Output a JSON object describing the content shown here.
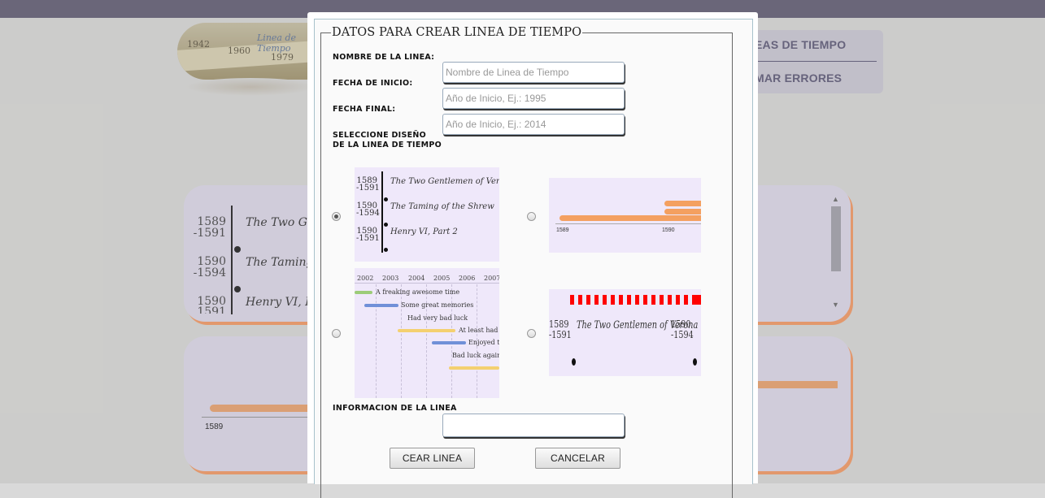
{
  "background": {
    "logo": {
      "text": "Linea de Tiempo",
      "years": [
        "1942",
        "1960",
        "1979"
      ]
    },
    "menu": {
      "item1": "EAS DE TIEMPO",
      "item2": "MAR ERRORES"
    },
    "card1": {
      "entries": [
        {
          "start": "1589",
          "end": "-1591",
          "title": "The Two Ge"
        },
        {
          "start": "1590",
          "end": "-1594",
          "title": "The Taming"
        },
        {
          "start": "1590",
          "end": "1591",
          "title": "Henry VI, P"
        }
      ]
    },
    "card2": {
      "axis_label": "1589"
    }
  },
  "modal": {
    "legend": "DATOS PARA CREAR LINEA DE TIEMPO",
    "label_name": "NOMBRE DE LA LINEA:",
    "label_start": "FECHA DE INICIO:",
    "label_end": "FECHA FINAL:",
    "label_design_1": "SELECCIONE DISEÑO",
    "label_design_2": "DE LA LINEA DE TIEMPO",
    "label_info": "INFORMACION DE LA LINEA",
    "name_placeholder": "Nombre de Linea de Tiempo",
    "start_placeholder": "Año de Inicio, Ej.: 1995",
    "end_placeholder": "Año de Inicio, Ej.: 2014",
    "info_value": "",
    "create_button": "CEAR LINEA",
    "cancel_button": "CANCELAR",
    "selected_design": 1,
    "design1": {
      "entries": [
        {
          "start": "1589",
          "end": "-1591",
          "title": "The Two Gentlemen of Verona"
        },
        {
          "start": "1590",
          "end": "-1594",
          "title": "The Taming of the Shrew"
        },
        {
          "start": "1590",
          "end": "-1591",
          "title": "Henry VI, Part 2"
        }
      ]
    },
    "design2": {
      "axis_labels": [
        "1589",
        "1590"
      ]
    },
    "design3": {
      "years": [
        "2002",
        "2003",
        "2004",
        "2005",
        "2006",
        "2007"
      ],
      "events": [
        {
          "label": "A freaking awesome time",
          "color": "#9ccc78"
        },
        {
          "label": "Some great memories",
          "color": "#7090d8"
        },
        {
          "label": "Had very bad luck",
          "color": "#f4d070"
        },
        {
          "label": "At least had fun",
          "color": "#f4d070"
        },
        {
          "label": "Enjoyed tho",
          "color": "#7090d8"
        },
        {
          "label": "Bad luck again",
          "color": "#f4d070"
        }
      ]
    },
    "design4": {
      "entries": [
        {
          "start": "1589",
          "end": "-1591",
          "title": "The Two Gentlemen of Verona"
        },
        {
          "start": "1590",
          "end": "-1594",
          "title": ""
        }
      ]
    }
  }
}
